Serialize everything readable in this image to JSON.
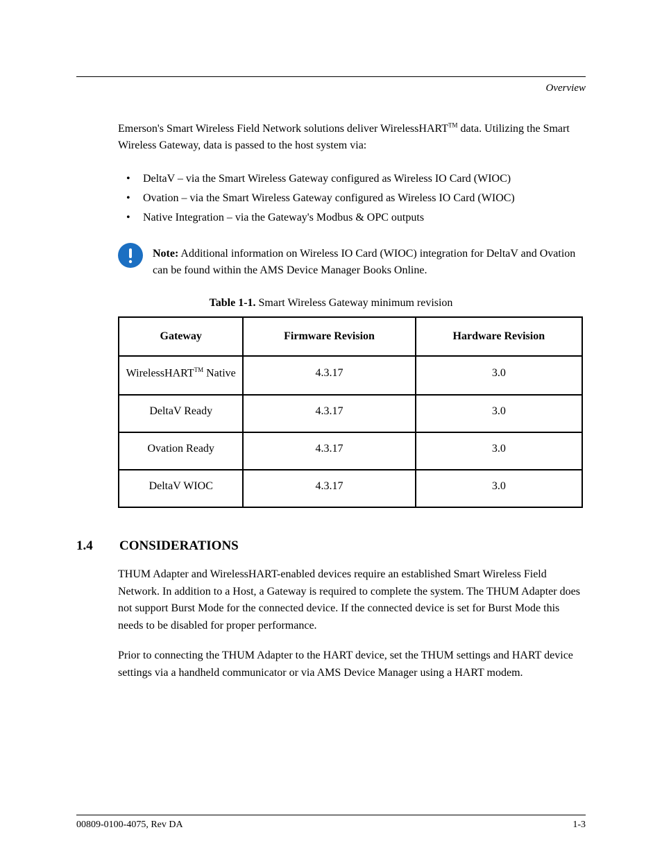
{
  "header": {
    "section_title": "Overview"
  },
  "intro": {
    "text_before_tm": "Emerson's Smart Wireless Field Network solutions deliver Wireless",
    "hart_word": "HART",
    "text_after_tm": " data. Utilizing the Smart Wireless Gateway, data is passed to the host system via:"
  },
  "bullets": [
    "DeltaV – via the Smart Wireless Gateway configured as Wireless IO Card (WIOC)",
    "Ovation – via the Smart Wireless Gateway configured as Wireless IO Card (WIOC)",
    "Native Integration – via the Gateway's Modbus & OPC outputs"
  ],
  "note": {
    "label": "Note:",
    "text": " Additional information on Wireless IO Card (WIOC) integration for DeltaV and Ovation can be found within the AMS Device Manager Books Online."
  },
  "table": {
    "caption_label": "Table 1-1. ",
    "caption_text": "Smart Wireless Gateway minimum revision",
    "headers": [
      "Gateway",
      "Firmware Revision",
      "Hardware Revision"
    ],
    "rows": [
      {
        "col1_pre": "Wireless",
        "col1_hart": "HART",
        "col1_post": " Native",
        "col2": "4.3.17",
        "col3": "3.0"
      },
      {
        "col1_pre": "DeltaV Ready",
        "col1_hart": "",
        "col1_post": "",
        "col2": "4.3.17",
        "col3": "3.0"
      },
      {
        "col1_pre": "Ovation Ready",
        "col1_hart": "",
        "col1_post": "",
        "col2": "4.3.17",
        "col3": "3.0"
      },
      {
        "col1_pre": "DeltaV WIOC",
        "col1_hart": "",
        "col1_post": "",
        "col2": "4.3.17",
        "col3": "3.0"
      }
    ]
  },
  "section": {
    "number": "1.4",
    "title": "CONSIDERATIONS"
  },
  "body": {
    "p1": "THUM Adapter and WirelessHART-enabled devices require an established Smart Wireless Field Network. In addition to a Host, a Gateway is required to complete the system. The THUM Adapter does not support Burst Mode for the connected device. If the connected device is set for Burst Mode this needs to be disabled for proper performance.",
    "p2": "Prior to connecting the THUM Adapter to the HART device, set the THUM settings and HART device settings via a handheld communicator or via AMS Device Manager using a HART modem."
  },
  "footer": {
    "left": "00809-0100-4075, Rev DA",
    "right": "1-3"
  }
}
